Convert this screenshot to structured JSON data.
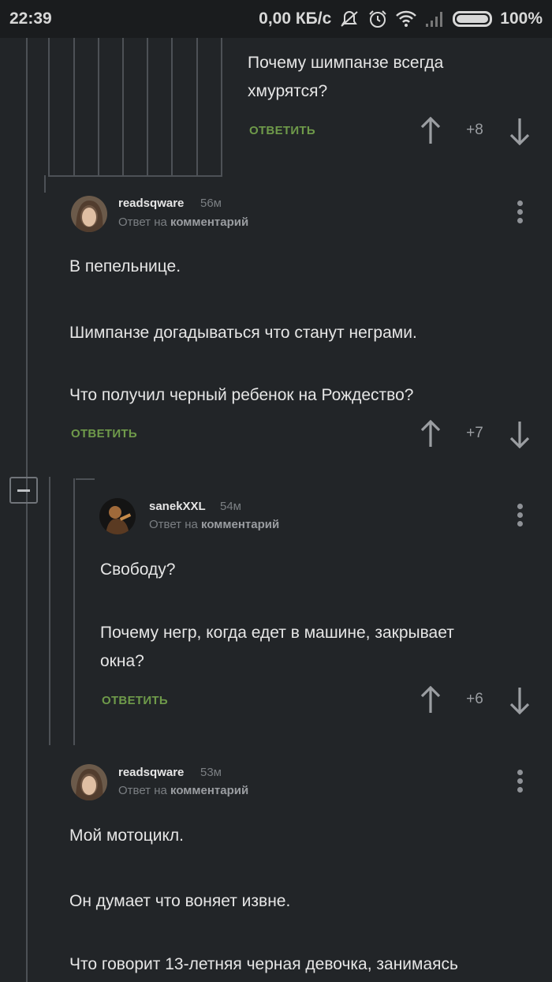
{
  "status_bar": {
    "time": "22:39",
    "network_speed": "0,00 КБ/с",
    "battery": "100%",
    "icons": [
      "mute-icon",
      "alarm-icon",
      "wifi-icon",
      "signal-icon",
      "battery-icon"
    ]
  },
  "colors": {
    "background": "#222528",
    "reply_accent": "#6f9a4a",
    "thread_line": "#4d5156"
  },
  "comments": [
    {
      "text_lines": [
        "Почему шимпанзе всегда",
        "хмурятся?"
      ],
      "reply_label": "ОТВЕТИТЬ",
      "score": "+8"
    },
    {
      "user": "readsqware",
      "time": "56м",
      "reply_prefix": "Ответ на",
      "reply_target": "комментарий",
      "paragraphs": [
        "В пепельнице.",
        "Шимпанзе догадываться что станут неграми.",
        "Что получил черный ребенок на Рождество?"
      ],
      "reply_label": "ОТВЕТИТЬ",
      "score": "+7"
    },
    {
      "user": "sanekXXL",
      "time": "54м",
      "reply_prefix": "Ответ на",
      "reply_target": "комментарий",
      "paragraphs": [
        "Свободу?",
        "Почему негр, когда едет в машине, закрывает",
        "окна?"
      ],
      "reply_label": "ОТВЕТИТЬ",
      "score": "+6"
    },
    {
      "user": "readsqware",
      "time": "53м",
      "reply_prefix": "Ответ на",
      "reply_target": "комментарий",
      "paragraphs": [
        "Мой мотоцикл.",
        "Он думает что воняет извне.",
        "Что говорит 13-летняя черная девочка, занимаясь"
      ]
    }
  ]
}
